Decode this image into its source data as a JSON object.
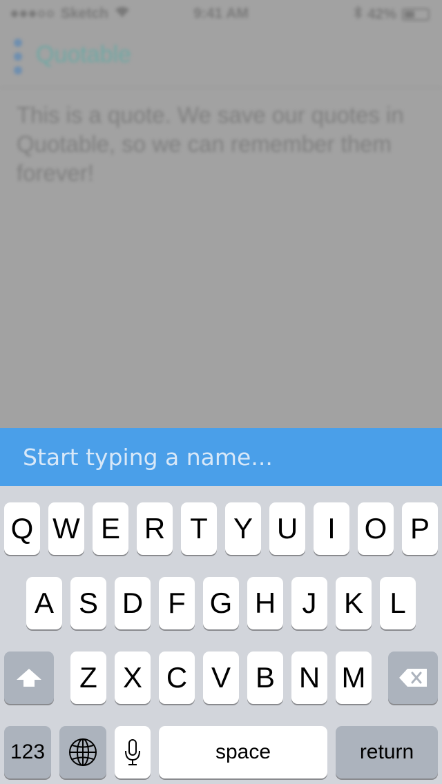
{
  "status_bar": {
    "carrier": "Sketch",
    "time": "9:41 AM",
    "battery": "42%"
  },
  "nav": {
    "title": "Quotable"
  },
  "quote": {
    "text": "This is a quote. We save our quotes in Quotable, so we can remember them forever!"
  },
  "name_field": {
    "placeholder": "Start typing a name...",
    "value": ""
  },
  "keyboard": {
    "row1": [
      "Q",
      "W",
      "E",
      "R",
      "T",
      "Y",
      "U",
      "I",
      "O",
      "P"
    ],
    "row2": [
      "A",
      "S",
      "D",
      "F",
      "G",
      "H",
      "J",
      "K",
      "L"
    ],
    "row3": [
      "Z",
      "X",
      "C",
      "V",
      "B",
      "N",
      "M"
    ],
    "numbers_label": "123",
    "space_label": "space",
    "return_label": "return"
  },
  "colors": {
    "accent": "#4a9fe9",
    "keyboard_bg": "#d2d5db"
  }
}
